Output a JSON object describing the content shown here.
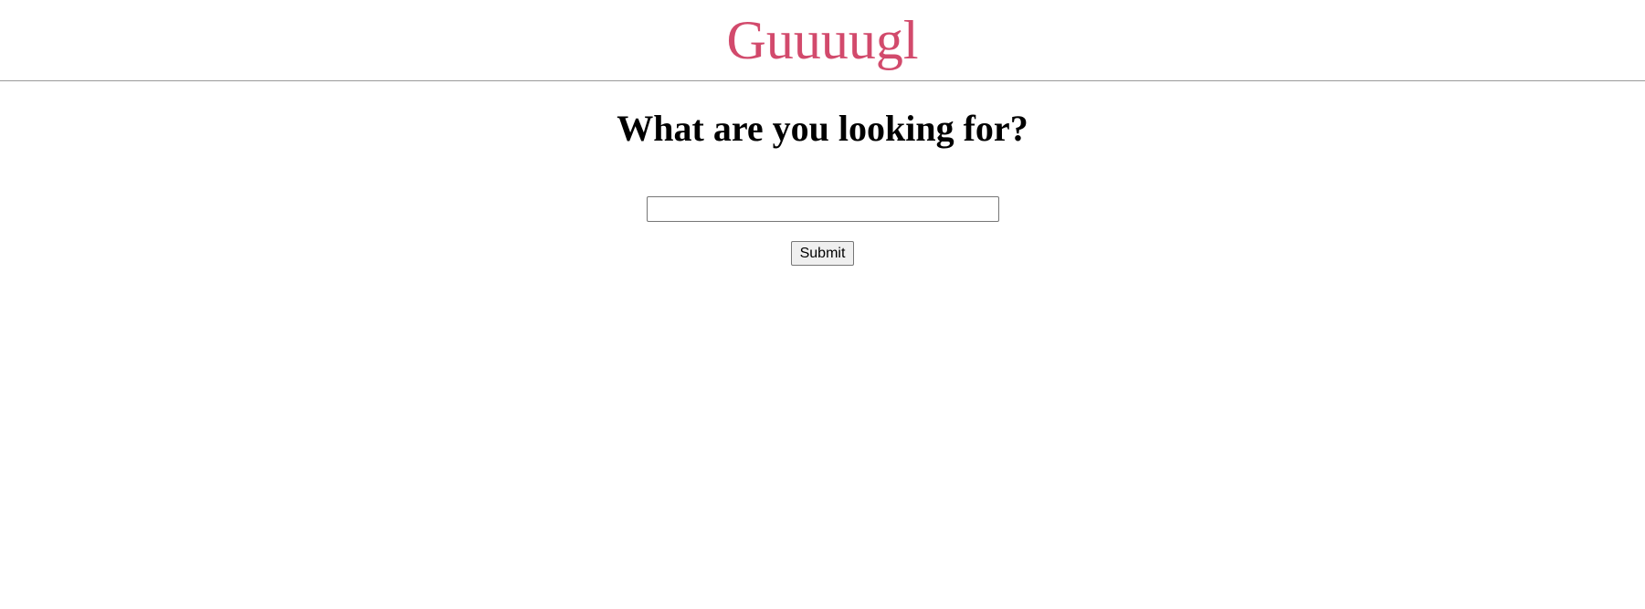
{
  "header": {
    "brand": "Guuuugl",
    "brand_color": "#d24a6c"
  },
  "main": {
    "title": "What are you looking for?",
    "search": {
      "value": "",
      "placeholder": ""
    },
    "submit_label": "Submit"
  }
}
